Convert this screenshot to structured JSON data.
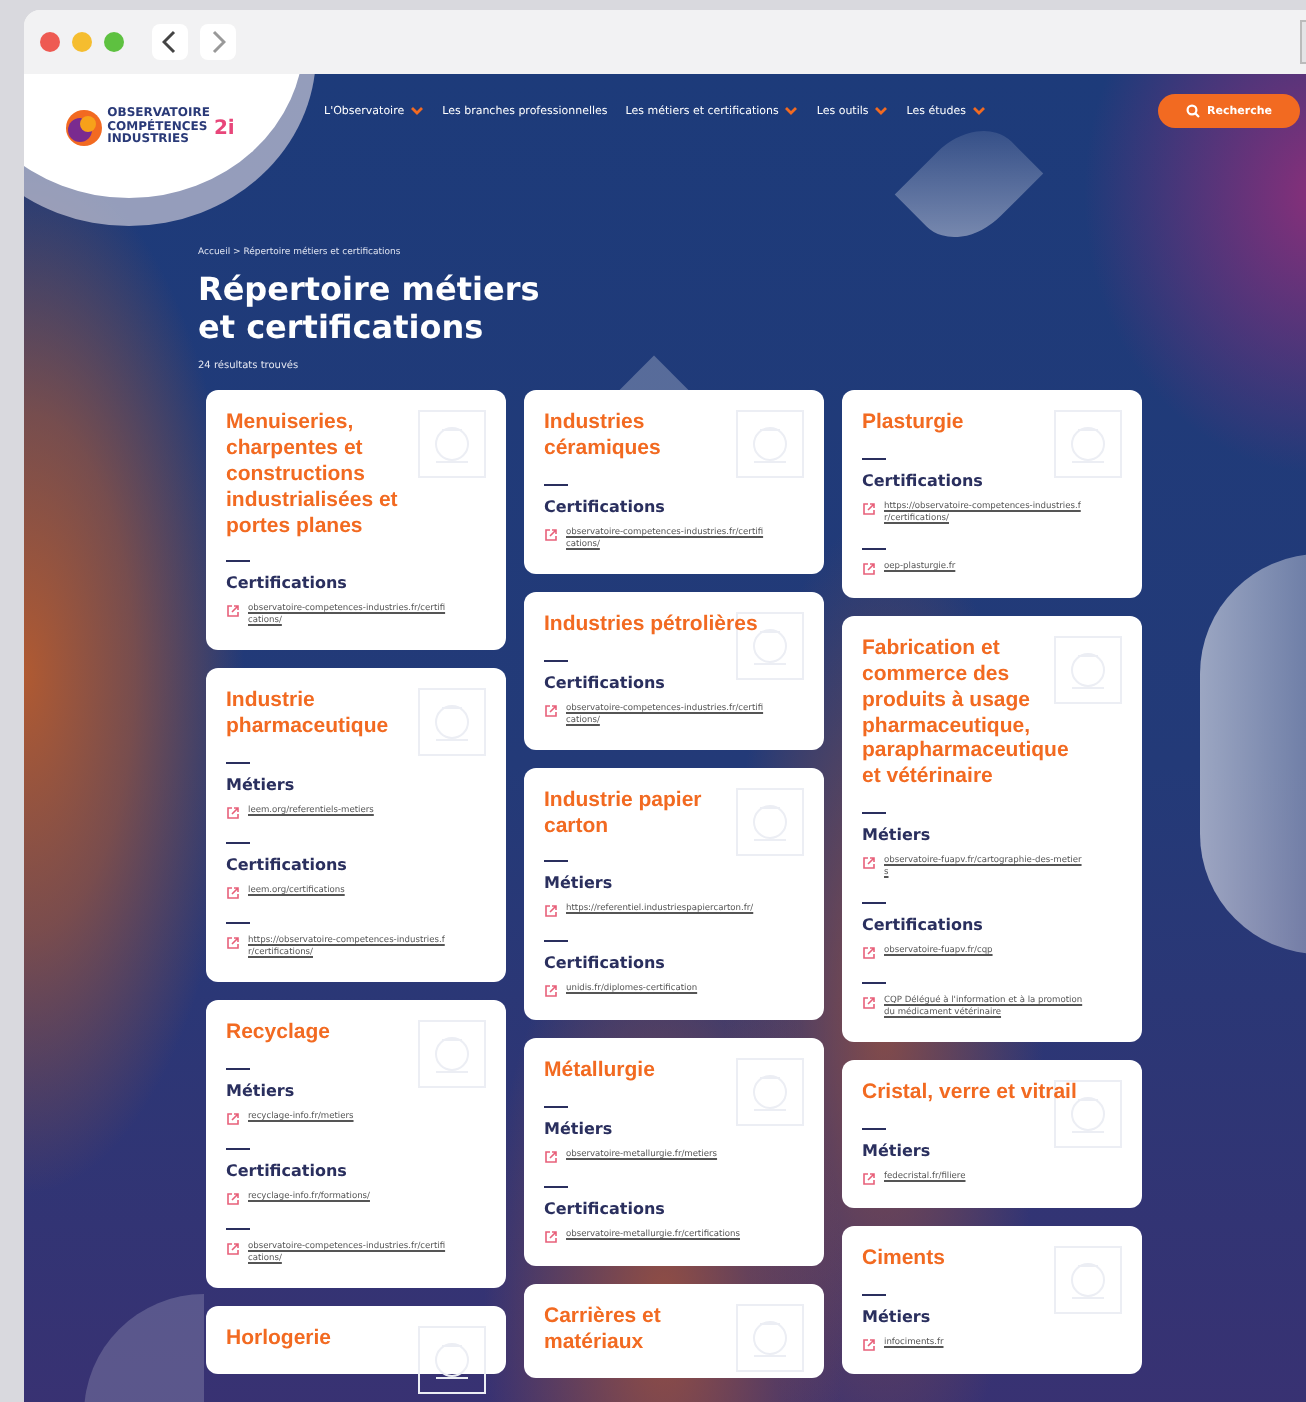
{
  "logo": {
    "lines": [
      "OBSERVATOIRE",
      "COMPÉTENCES",
      "INDUSTRIES"
    ],
    "badge": "2i"
  },
  "nav": [
    {
      "label": "L'Observatoire",
      "has_menu": true
    },
    {
      "label": "Les branches professionnelles",
      "has_menu": false
    },
    {
      "label": "Les métiers et certifications",
      "has_menu": true
    },
    {
      "label": "Les outils",
      "has_menu": true
    },
    {
      "label": "Les études",
      "has_menu": true
    }
  ],
  "search_button": "Recherche",
  "breadcrumb": "Accueil > Répertoire métiers et certifications",
  "title": [
    "Répertoire métiers",
    "et certifications"
  ],
  "result_count": "24 résultats trouvés",
  "columns": [
    [
      {
        "title": "Menuiseries, charpentes et constructions industrialisées et portes planes",
        "sections": [
          {
            "heading": "Certifications",
            "links": [
              "observatoire-competences-industries.fr/certifications/"
            ]
          }
        ]
      },
      {
        "title": "Industrie pharmaceutique",
        "sections": [
          {
            "heading": "Métiers",
            "links": [
              "leem.org/referentiels-metiers"
            ]
          },
          {
            "heading": "Certifications",
            "links": [
              "leem.org/certifications"
            ]
          },
          {
            "links": [
              "https://observatoire-competences-industries.fr/certifications/"
            ]
          }
        ]
      },
      {
        "title": "Recyclage",
        "sections": [
          {
            "heading": "Métiers",
            "links": [
              "recyclage-info.fr/metiers"
            ]
          },
          {
            "heading": "Certifications",
            "links": [
              "recyclage-info.fr/formations/"
            ]
          },
          {
            "links": [
              "observatoire-competences-industries.fr/certifications/"
            ]
          }
        ]
      },
      {
        "title": "Horlogerie"
      }
    ],
    [
      {
        "title": "Industries céramiques",
        "sections": [
          {
            "heading": "Certifications",
            "links": [
              "observatoire-competences-industries.fr/certifications/"
            ]
          }
        ]
      },
      {
        "title": "Industries pétrolières",
        "sections": [
          {
            "heading": "Certifications",
            "links": [
              "observatoire-competences-industries.fr/certifications/"
            ]
          }
        ]
      },
      {
        "title": "Industrie papier carton",
        "sections": [
          {
            "heading": "Métiers",
            "links": [
              "https://referentiel.industriespapiercarton.fr/"
            ]
          },
          {
            "heading": "Certifications",
            "links": [
              "unidis.fr/diplomes-certification"
            ]
          }
        ]
      },
      {
        "title": "Métallurgie",
        "sections": [
          {
            "heading": "Métiers",
            "links": [
              "observatoire-metallurgie.fr/metiers"
            ]
          },
          {
            "heading": "Certifications",
            "links": [
              "observatoire-metallurgie.fr/certifications"
            ]
          }
        ]
      },
      {
        "title": "Carrières et matériaux"
      }
    ],
    [
      {
        "title": "Plasturgie",
        "sections": [
          {
            "heading": "Certifications",
            "links": [
              "https://observatoire-competences-industries.fr/certifications/"
            ]
          },
          {
            "links": [
              "oep-plasturgie.fr"
            ]
          }
        ]
      },
      {
        "title": "Fabrication et commerce des produits à usage pharmaceutique, parapharmaceutique et vétérinaire",
        "sections": [
          {
            "heading": "Métiers",
            "links": [
              "observatoire-fuapv.fr/cartographie-des-metiers"
            ]
          },
          {
            "heading": "Certifications",
            "links": [
              "observatoire-fuapv.fr/cqp"
            ]
          },
          {
            "links": [
              "CQP Délégué à l'information et à la promotion du médicament vétérinaire"
            ]
          }
        ]
      },
      {
        "title": "Cristal, verre et vitrail",
        "sections": [
          {
            "heading": "Métiers",
            "links": [
              "fedecristal.fr/filiere"
            ]
          }
        ]
      },
      {
        "title": "Ciments",
        "sections": [
          {
            "heading": "Métiers",
            "links": [
              "infociments.fr"
            ]
          }
        ]
      }
    ]
  ]
}
